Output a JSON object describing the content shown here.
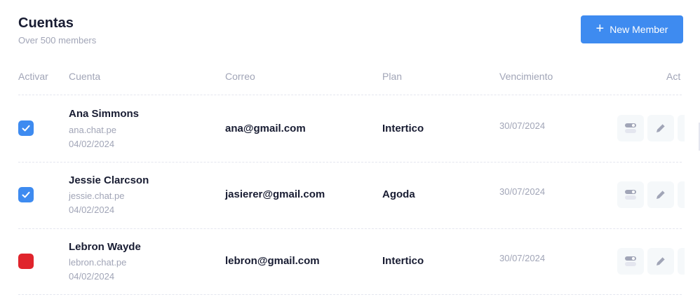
{
  "header": {
    "title": "Cuentas",
    "subtitle": "Over 500 members",
    "new_member_label": "New Member",
    "plus_icon": "+"
  },
  "table": {
    "columns": [
      "Activar",
      "Cuenta",
      "Correo",
      "Plan",
      "Vencimiento",
      "Act"
    ],
    "rows": [
      {
        "active": true,
        "name": "Ana Simmons",
        "domain": "ana.chat.pe",
        "created": "04/02/2024",
        "email": "ana@gmail.com",
        "plan": "Intertico",
        "expiry": "30/07/2024"
      },
      {
        "active": true,
        "name": "Jessie Clarcson",
        "domain": "jessie.chat.pe",
        "created": "04/02/2024",
        "email": "jasierer@gmail.com",
        "plan": "Agoda",
        "expiry": "30/07/2024"
      },
      {
        "active": false,
        "name": "Lebron Wayde",
        "domain": "lebron.chat.pe",
        "created": "04/02/2024",
        "email": "lebron@gmail.com",
        "plan": "Intertico",
        "expiry": "30/07/2024"
      }
    ]
  },
  "colors": {
    "accent": "#3e8bf0",
    "checked": "#3e8bf0",
    "inactive": "#e0242c",
    "muted_text": "#a1a5b7",
    "dark_text": "#181c32",
    "action_bg": "#f5f8fa"
  },
  "icons": {
    "checkbox_checked": "check-icon",
    "toggle": "toggle-icon",
    "edit": "pencil-icon",
    "add": "plus-icon"
  }
}
